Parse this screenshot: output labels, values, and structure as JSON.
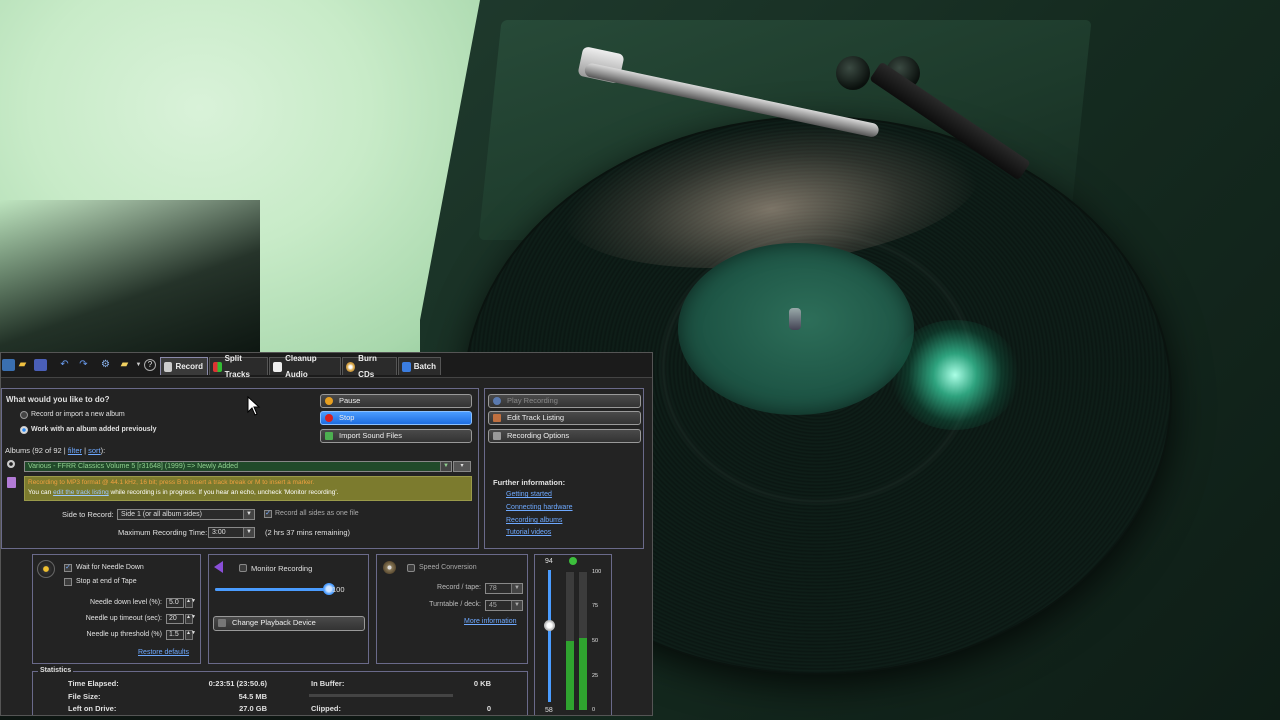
{
  "app": {
    "toolbar": {
      "tabs": [
        {
          "label": "Record",
          "icon": "record-icon",
          "active": true
        },
        {
          "label": "Split Tracks",
          "icon": "split-tracks-icon"
        },
        {
          "label": "Cleanup Audio",
          "icon": "cleanup-audio-icon"
        },
        {
          "label": "Burn CDs",
          "icon": "burn-cd-icon"
        },
        {
          "label": "Batch",
          "icon": "batch-icon"
        }
      ]
    },
    "mode": {
      "question": "What would you like to do?",
      "option_new": "Record or import a new album",
      "option_previous": "Work with an album added previously"
    },
    "albums": {
      "prefix": "Albums (92 of 92 |",
      "filter": "filter",
      "sep": "|",
      "sort": "sort",
      "suffix": "):",
      "selected": "Various - FFRR Classics Volume 5 [r31648] (1999) => Newly Added"
    },
    "notice": {
      "line1": "Recording to MP3 format @ 44.1 kHz, 16 bit; press B to insert a track break or M to insert a marker.",
      "line2_prefix": "You can",
      "line2_link": "edit the track listing",
      "line2_suffix": "while recording is in progress.  If you hear an echo, uncheck 'Monitor recording'."
    },
    "side": {
      "label": "Side to Record:",
      "value": "Side 1 (or all album sides)",
      "record_all_label": "Record all sides as one file"
    },
    "max_time": {
      "label": "Maximum Recording Time:",
      "value": "3:00",
      "remaining": "(2 hrs 37 mins remaining)"
    },
    "transport": {
      "pause": "Pause",
      "stop": "Stop",
      "import": "Import Sound Files"
    },
    "right_buttons": {
      "play": "Play Recording",
      "edit": "Edit Track Listing",
      "options": "Recording Options"
    },
    "info": {
      "title": "Further information:",
      "links": [
        "Getting started",
        "Connecting hardware",
        "Recording albums",
        "Tutorial videos"
      ]
    },
    "needle": {
      "wait": "Wait for Needle Down",
      "stop_tape": "Stop at end of Tape",
      "down_level_label": "Needle down level (%):",
      "down_level": "5.0",
      "up_timeout_label": "Needle up timeout (sec):",
      "up_timeout": "20",
      "up_threshold_label": "Needle up threshold (%)",
      "up_threshold": "1.5",
      "restore": "Restore defaults"
    },
    "monitor": {
      "label": "Monitor Recording",
      "volume": "100",
      "volume_level": 1.0,
      "change_device": "Change Playback Device"
    },
    "speed": {
      "label": "Speed Conversion",
      "record_label": "Record / tape:",
      "record_value": "78",
      "turntable_label": "Turntable / deck:",
      "turntable_value": "45",
      "more": "More information"
    },
    "meter": {
      "top": "94",
      "bottom": "58",
      "scale": [
        "100",
        "75",
        "50",
        "25",
        "0"
      ],
      "left_level": 0.5,
      "right_level": 0.52
    },
    "stats": {
      "title": "Statistics",
      "time_elapsed_label": "Time Elapsed:",
      "time_elapsed": "0:23:51 (23:50.6)",
      "file_size_label": "File Size:",
      "file_size": "54.5 MB",
      "left_drive_label": "Left on Drive:",
      "left_drive": "27.0 GB",
      "buffer_label": "In Buffer:",
      "buffer": "0 KB",
      "clipped_label": "Clipped:",
      "clipped": "0"
    }
  }
}
